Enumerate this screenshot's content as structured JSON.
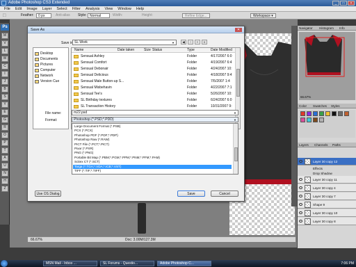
{
  "app": {
    "title": "Adobe Photoshop CS3 Extended",
    "menu": [
      "File",
      "Edit",
      "Image",
      "Layer",
      "Select",
      "Filter",
      "Analysis",
      "View",
      "Window",
      "Help"
    ],
    "window_controls": [
      "_",
      "□",
      "×"
    ]
  },
  "options_bar": {
    "feather_label": "Feather:",
    "feather_value": "0 px",
    "anti_alias_label": "Anti-alias",
    "style_label": "Style:",
    "style_value": "Normal",
    "width_label": "Width:",
    "height_label": "Height:",
    "refine_edge_label": "Refine Edge...",
    "workspace_label": "Workspace ▾"
  },
  "tools": [
    "M",
    "V",
    "L",
    "W",
    "C",
    "I",
    "J",
    "B",
    "S",
    "Y",
    "E",
    "G",
    "R",
    "O",
    "P",
    "T",
    "A",
    "U",
    "N",
    "H",
    "Z"
  ],
  "dialog": {
    "title": "Save As",
    "save_in_label": "Save in:",
    "save_in_value": "SL Work",
    "places": [
      "Desktop",
      "Documents",
      "Pictures",
      "Computer",
      "Network",
      "Version Cue"
    ],
    "columns": [
      "Name",
      "Date taken",
      "Size",
      "Status",
      "Type",
      "Date Modified"
    ],
    "files": [
      {
        "name": "Sensual Ashley",
        "type": "Folder",
        "date": "4/17/2007 6:0"
      },
      {
        "name": "Sensual Comfort",
        "type": "Folder",
        "date": "4/19/2007 6:4"
      },
      {
        "name": "Sensual Debonair",
        "type": "Folder",
        "date": "4/24/2007 10:"
      },
      {
        "name": "Sensual Delicious",
        "type": "Folder",
        "date": "4/18/2007 9:4"
      },
      {
        "name": "Sensual Male Button-up S...",
        "type": "Folder",
        "date": "7/5/2007 1:4"
      },
      {
        "name": "Sensual Misbehavin",
        "type": "Folder",
        "date": "4/22/2007 7:1"
      },
      {
        "name": "Sensual Tee's",
        "type": "Folder",
        "date": "5/26/2007 10:"
      },
      {
        "name": "SL Birthday textures",
        "type": "Folder",
        "date": "6/24/2007 6:0"
      },
      {
        "name": "SL Transaction History",
        "type": "Folder",
        "date": "10/31/2007 9:"
      }
    ],
    "file_name_label": "File name:",
    "file_name_value": "m22.psd",
    "format_label": "Format:",
    "format_value": "Photoshop (*.PSD;*.PDD)",
    "formats": [
      "Large Document Format (*.PSB)",
      "PCX (*.PCX)",
      "Photoshop PDF (*.PDF;*.PDP)",
      "Photoshop Raw (*.RAW)",
      "PICT File (*.PCT;*.PICT)",
      "Pixar (*.PXR)",
      "PNG (*.PNG)",
      "Portable Bit Map (*.PBM;*.PGM;*.PPM;*.PNM;*.PFM;*.PAM)",
      "Scitex CT (*.SCT)",
      "Targa (*.TGA;*.VDA;*.ICB;*.VST)",
      "TIFF (*.TIF;*.TIFF)"
    ],
    "selected_format_index": 9,
    "use_os_dialog_label": "Use OS Dialog",
    "save_label": "Save",
    "cancel_label": "Cancel"
  },
  "canvas": {
    "zoom": "66.67%",
    "doc_info": "Doc: 3.00M/127.3M"
  },
  "panels": {
    "navigator_tabs": [
      "Navigator",
      "Histogram",
      "Info"
    ],
    "navigator_zoom": "66.67%",
    "swatch_tabs": [
      "Color",
      "Swatches",
      "Styles"
    ],
    "layer_tabs": [
      "Layers",
      "Channels",
      "Paths"
    ],
    "swatch_colors": [
      "#e0382b",
      "#8a2be2",
      "#2a6fd6",
      "#3aa04a",
      "#f2c230",
      "#111111",
      "#6b6b6b",
      "#c06030",
      "#d94e9a",
      "#3cc7d9",
      "#7d4a1c",
      "#b0b0b0"
    ],
    "layers": [
      {
        "name": "Layer 30 copy 12",
        "selected": true
      },
      {
        "name": "Effects",
        "fx": true
      },
      {
        "name": "Drop Shadow",
        "fx": true
      },
      {
        "name": "Layer 30 copy 11"
      },
      {
        "name": "Layer 30 copy 4"
      },
      {
        "name": "Layer 30 copy 7"
      },
      {
        "name": "Shape 9"
      },
      {
        "name": "Layer 30 copy 10"
      },
      {
        "name": "Layer 30 copy 8"
      }
    ]
  },
  "taskbar": {
    "items": [
      "MSN Mail - Inbox ...",
      "SL Forums - Questio...",
      "Adobe Photoshop C..."
    ],
    "active_index": 2,
    "clock": "7:06 PM"
  }
}
